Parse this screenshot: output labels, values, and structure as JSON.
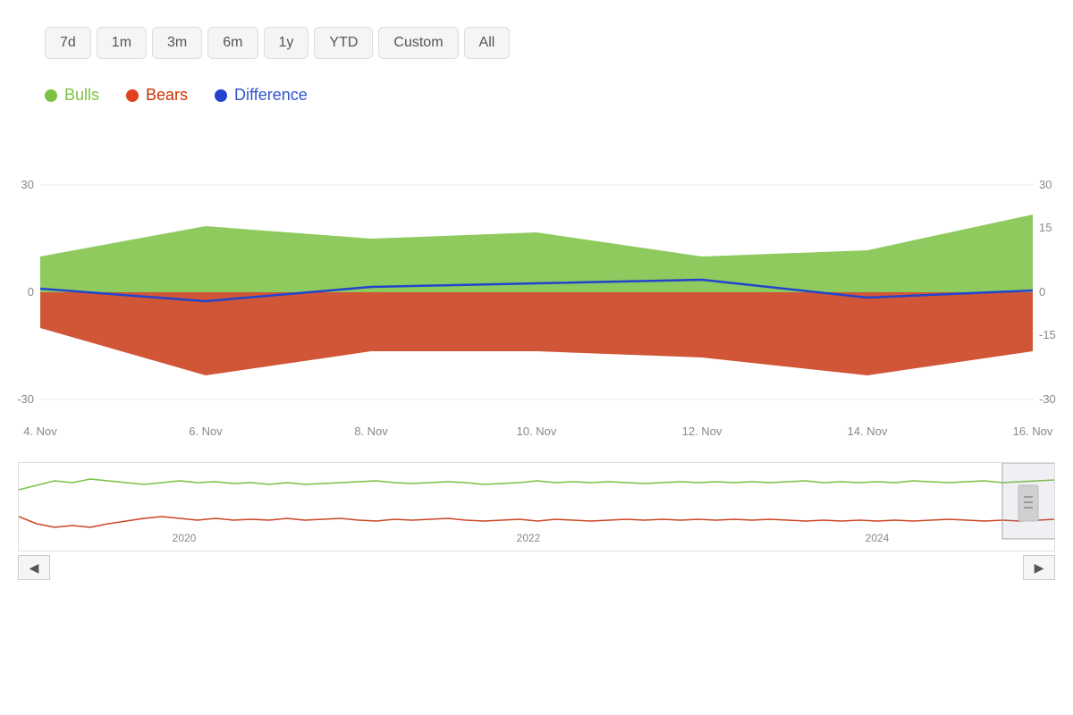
{
  "timeButtons": {
    "buttons": [
      "7d",
      "1m",
      "3m",
      "6m",
      "1y",
      "YTD",
      "Custom",
      "All"
    ]
  },
  "legend": {
    "items": [
      {
        "label": "Bulls",
        "color": "#7bc142",
        "dotColor": "#7bc142"
      },
      {
        "label": "Bears",
        "color": "#cc3300",
        "dotColor": "#e04020"
      },
      {
        "label": "Difference",
        "color": "#3355cc",
        "dotColor": "#2244cc"
      }
    ]
  },
  "yAxis": {
    "left": [
      "30",
      "0",
      "-30"
    ],
    "right": [
      "30",
      "15",
      "0",
      "-15",
      "-30"
    ]
  },
  "xAxis": {
    "labels": [
      "4. Nov",
      "6. Nov",
      "8. Nov",
      "10. Nov",
      "12. Nov",
      "14. Nov",
      "16. Nov"
    ]
  },
  "overviewYears": [
    "2020",
    "2022",
    "2024"
  ]
}
